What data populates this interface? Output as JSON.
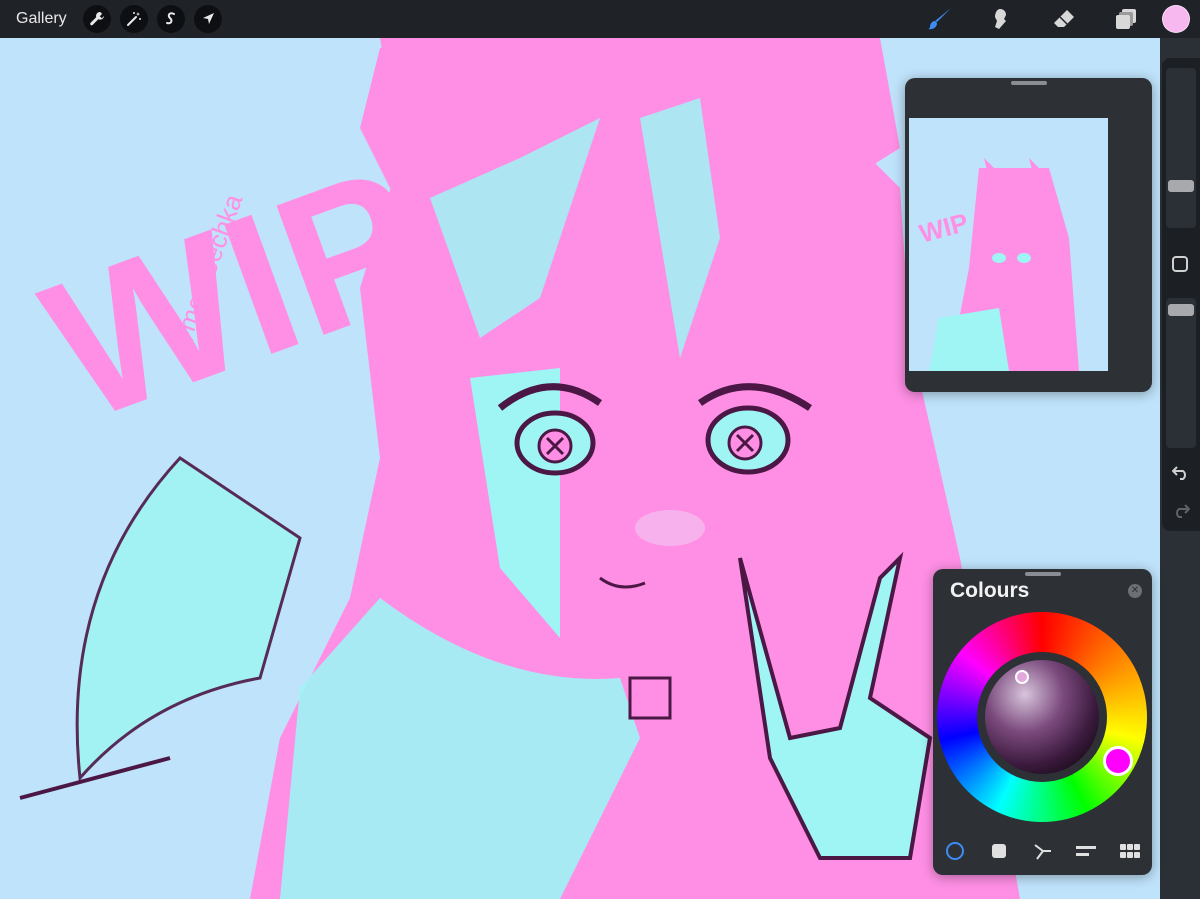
{
  "toolbar": {
    "gallery_label": "Gallery",
    "left_tools": [
      "wrench-icon",
      "magic-wand-icon",
      "selection-icon",
      "transform-arrow-icon"
    ],
    "right_tools": [
      "brush-icon",
      "smudge-icon",
      "eraser-icon",
      "layers-icon"
    ],
    "current_color": "#f6b8ef"
  },
  "canvas": {
    "background": "#bfe3fb",
    "wip_text": "WIP",
    "watermark": "@moreeechka",
    "accent_pink": "#ff8fe5",
    "accent_cyan": "#9ff4f4"
  },
  "colours_panel": {
    "title": "Colours",
    "selected_hue": "#ff00ff",
    "selected_color": "#e2a7dc",
    "tabs": [
      "disc-icon",
      "classic-icon",
      "harmony-icon",
      "value-icon",
      "palettes-icon"
    ]
  }
}
